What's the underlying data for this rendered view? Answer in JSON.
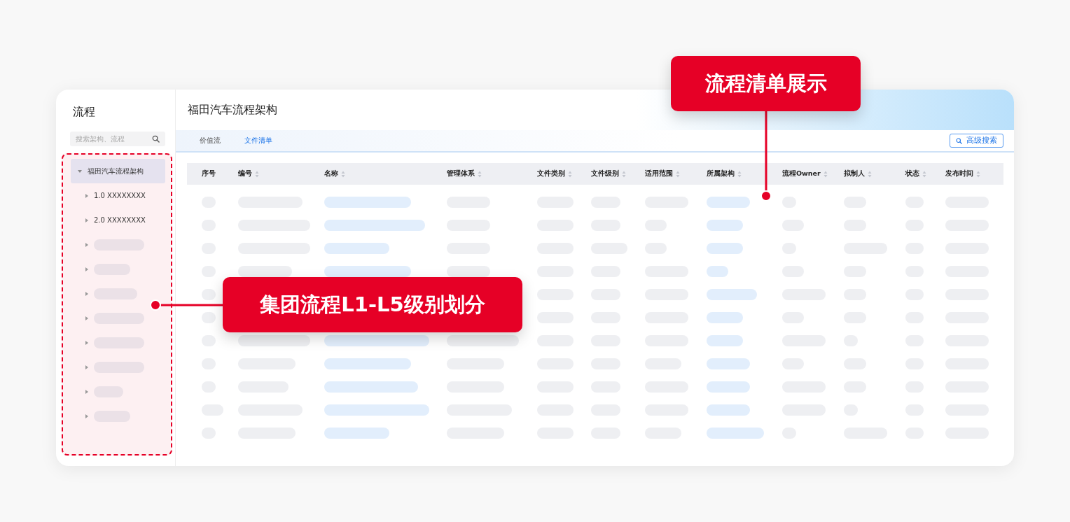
{
  "sidebar": {
    "title": "流程",
    "search": {
      "placeholder": "搜索架构、流程"
    },
    "tree": [
      {
        "label": "福田汽车流程架构",
        "expanded": true,
        "selected": true,
        "children": [
          {
            "kind": "text",
            "label": "1.0 XXXXXXXX",
            "expanded": false,
            "selected": false
          },
          {
            "kind": "text",
            "label": "2.0 XXXXXXXX",
            "expanded": false,
            "selected": false
          },
          {
            "kind": "placeholder",
            "expanded": false,
            "selected": false
          },
          {
            "kind": "placeholder",
            "expanded": false,
            "selected": false
          },
          {
            "kind": "placeholder",
            "expanded": false,
            "selected": false
          },
          {
            "kind": "placeholder",
            "expanded": false,
            "selected": false
          },
          {
            "kind": "placeholder",
            "expanded": false,
            "selected": false
          },
          {
            "kind": "placeholder",
            "expanded": false,
            "selected": false
          },
          {
            "kind": "placeholder",
            "expanded": false,
            "selected": false
          },
          {
            "kind": "placeholder",
            "expanded": false,
            "selected": false
          }
        ]
      }
    ]
  },
  "main": {
    "title": "福田汽车流程架构",
    "tabs": [
      {
        "label": "价值流",
        "selected": false
      },
      {
        "label": "文件清单",
        "selected": true
      }
    ],
    "advanced_search_button": "高级搜索",
    "table": {
      "loading": true,
      "columns": [
        {
          "label": "序号",
          "sortable": false
        },
        {
          "label": "编号",
          "sortable": true
        },
        {
          "label": "名称",
          "sortable": true
        },
        {
          "label": "管理体系",
          "sortable": true
        },
        {
          "label": "文件类别",
          "sortable": true
        },
        {
          "label": "文件级别",
          "sortable": true
        },
        {
          "label": "适用范围",
          "sortable": true
        },
        {
          "label": "所属架构",
          "sortable": true
        },
        {
          "label": "流程Owner",
          "sortable": true
        },
        {
          "label": "拟制人",
          "sortable": true
        },
        {
          "label": "状态",
          "sortable": true
        },
        {
          "label": "发布时间",
          "sortable": true
        }
      ]
    }
  },
  "annotations": [
    {
      "text": "流程清单展示"
    },
    {
      "text": "集团流程L1-L5级别划分"
    }
  ]
}
